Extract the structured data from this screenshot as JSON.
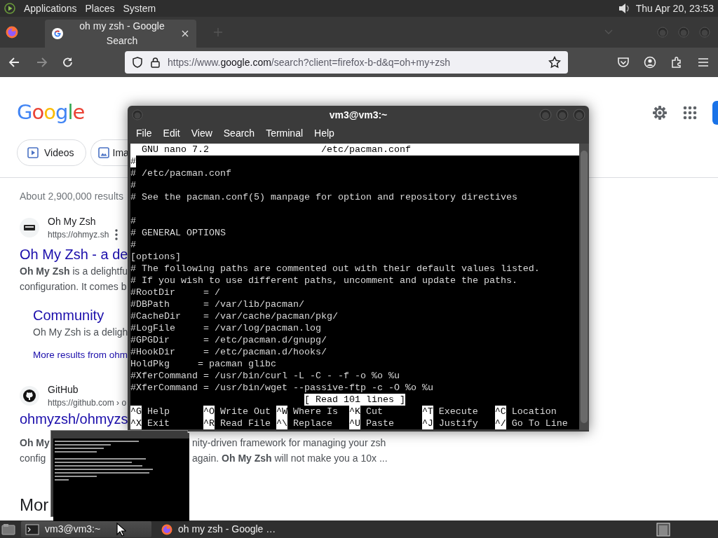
{
  "top_panel": {
    "menus": [
      {
        "label": "Applications"
      },
      {
        "label": "Places"
      },
      {
        "label": "System"
      }
    ],
    "clock": "Thu Apr 20, 23:53"
  },
  "browser": {
    "tabs": [
      {
        "title": "oh my zsh - Google Search",
        "selected": true
      }
    ],
    "nav_buttons": [
      {
        "kind": "back",
        "disabled": false
      },
      {
        "kind": "forward",
        "disabled": true
      },
      {
        "kind": "reload",
        "disabled": false
      }
    ],
    "url": {
      "prefix": "https://www.",
      "domain": "google.com",
      "path": "/search?client=firefox-b-d&q=oh+my+zsh"
    }
  },
  "google": {
    "logo": "Google",
    "chips": [
      {
        "label": "Videos",
        "kind": "video"
      },
      {
        "label": "Ima",
        "kind": "image"
      }
    ],
    "result_stats": "About 2,900,000 results",
    "results": [
      {
        "kind": "ohmyzsh",
        "site": "Oh My Zsh",
        "url": "https://ohmyz.sh",
        "title": "Oh My Zsh - a de",
        "snippet": [
          {
            "left": "**Oh My Zsh** is a delightfu"
          },
          {
            "left": "configuration. It comes b"
          }
        ],
        "sitelinks": [
          {
            "title": "Community",
            "text": "Oh My Zsh is a deligh"
          }
        ],
        "more": "More results from ohm"
      },
      {
        "kind": "github",
        "site": "GitHub",
        "url": "https://github.com › o",
        "title": "ohmyzsh/ohmyzs",
        "snippet": [
          {
            "left": "**Oh My**",
            "right": "nity-driven framework for managing your zsh"
          },
          {
            "left": "config",
            "right": "again. **Oh My Zsh** will not make you a 10x ..."
          }
        ]
      }
    ],
    "next_heading": "Mor"
  },
  "terminal": {
    "title": "vm3@vm3:~",
    "menu": [
      "File",
      "Edit",
      "View",
      "Search",
      "Terminal",
      "Help"
    ],
    "nano": {
      "version": "GNU nano 7.2",
      "file": "/etc/pacman.conf",
      "lines": [
        {
          "kind": "text",
          "text": "#",
          "cursor": true
        },
        {
          "kind": "text",
          "text": "# /etc/pacman.conf",
          "cursor": false
        },
        {
          "kind": "text",
          "text": "#",
          "cursor": false
        },
        {
          "kind": "text",
          "text": "# See the pacman.conf(5) manpage for option and repository directives",
          "cursor": false
        },
        {
          "kind": "blank"
        },
        {
          "kind": "text",
          "text": "#",
          "cursor": false
        },
        {
          "kind": "text",
          "text": "# GENERAL OPTIONS",
          "cursor": false
        },
        {
          "kind": "text",
          "text": "#",
          "cursor": false
        },
        {
          "kind": "text",
          "text": "[options]",
          "cursor": false
        },
        {
          "kind": "text",
          "text": "# The following paths are commented out with their default values listed.",
          "cursor": false
        },
        {
          "kind": "text",
          "text": "# If you wish to use different paths, uncomment and update the paths.",
          "cursor": false
        },
        {
          "kind": "text",
          "text": "#RootDir     = /",
          "cursor": false
        },
        {
          "kind": "text",
          "text": "#DBPath      = /var/lib/pacman/",
          "cursor": false
        },
        {
          "kind": "text",
          "text": "#CacheDir    = /var/cache/pacman/pkg/",
          "cursor": false
        },
        {
          "kind": "text",
          "text": "#LogFile     = /var/log/pacman.log",
          "cursor": false
        },
        {
          "kind": "text",
          "text": "#GPGDir      = /etc/pacman.d/gnupg/",
          "cursor": false
        },
        {
          "kind": "text",
          "text": "#HookDir     = /etc/pacman.d/hooks/",
          "cursor": false
        },
        {
          "kind": "text",
          "text": "HoldPkg     = pacman glibc",
          "cursor": false
        },
        {
          "kind": "text",
          "text": "#XferCommand = /usr/bin/curl -L -C - -f -o %o %u",
          "cursor": false
        },
        {
          "kind": "text",
          "text": "#XferCommand = /usr/bin/wget --passive-ftp -c -O %o %u",
          "cursor": false
        }
      ],
      "status": "[ Read 101 lines ]",
      "shortcuts": [
        [
          {
            "key": "^G",
            "label": "Help"
          },
          {
            "key": "^O",
            "label": "Write Out"
          },
          {
            "key": "^W",
            "label": "Where Is"
          },
          {
            "key": "^K",
            "label": "Cut"
          },
          {
            "key": "^T",
            "label": "Execute"
          },
          {
            "key": "^C",
            "label": "Location"
          }
        ],
        [
          {
            "key": "^X",
            "label": "Exit"
          },
          {
            "key": "^R",
            "label": "Read File"
          },
          {
            "key": "^\\",
            "label": "Replace"
          },
          {
            "key": "^U",
            "label": "Paste"
          },
          {
            "key": "^J",
            "label": "Justify"
          },
          {
            "key": "^/",
            "label": "Go To Line"
          }
        ]
      ]
    }
  },
  "taskbar": {
    "tasks": [
      {
        "kind": "terminal",
        "label": "vm3@vm3:~",
        "selected": true
      },
      {
        "kind": "firefox",
        "label": "oh my zsh - Google …",
        "selected": false
      }
    ]
  }
}
